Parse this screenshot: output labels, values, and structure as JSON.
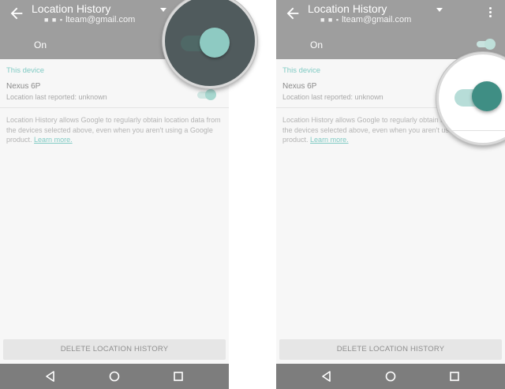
{
  "screens": [
    {
      "header": {
        "title": "Location History",
        "account_dots": "■ ■ ▪",
        "account": "lteam@gmail.com"
      },
      "status_label": "On",
      "section_label": "This device",
      "device": {
        "name": "Nexus 6P",
        "status": "Location last reported: unknown"
      },
      "description": "Location History allows Google to regularly obtain location data from the devices selected above, even when you aren't using a Google product.",
      "learn_more": "Learn more.",
      "delete_button": "DELETE LOCATION HISTORY"
    },
    {
      "header": {
        "title": "Location History",
        "account_dots": "■ ■ ▪",
        "account": "lteam@gmail.com"
      },
      "status_label": "On",
      "section_label": "This device",
      "device": {
        "name": "Nexus 6P",
        "status": "Location last reported: unknown"
      },
      "description": "Location History allows Google to regularly obtain location data from the devices selected above, even when you aren't using a Google product.",
      "learn_more": "Learn more.",
      "delete_button": "DELETE LOCATION HISTORY"
    }
  ],
  "colors": {
    "app_bar": "#9e9e9e",
    "accent_teal": "#80cbc4",
    "toggle_on_dark": "#3f8e84",
    "nav_bar": "#7d7d7d"
  },
  "icons": [
    "back-arrow-icon",
    "dropdown-caret-icon",
    "overflow-menu-icon",
    "nav-back-icon",
    "nav-home-icon",
    "nav-recents-icon"
  ]
}
